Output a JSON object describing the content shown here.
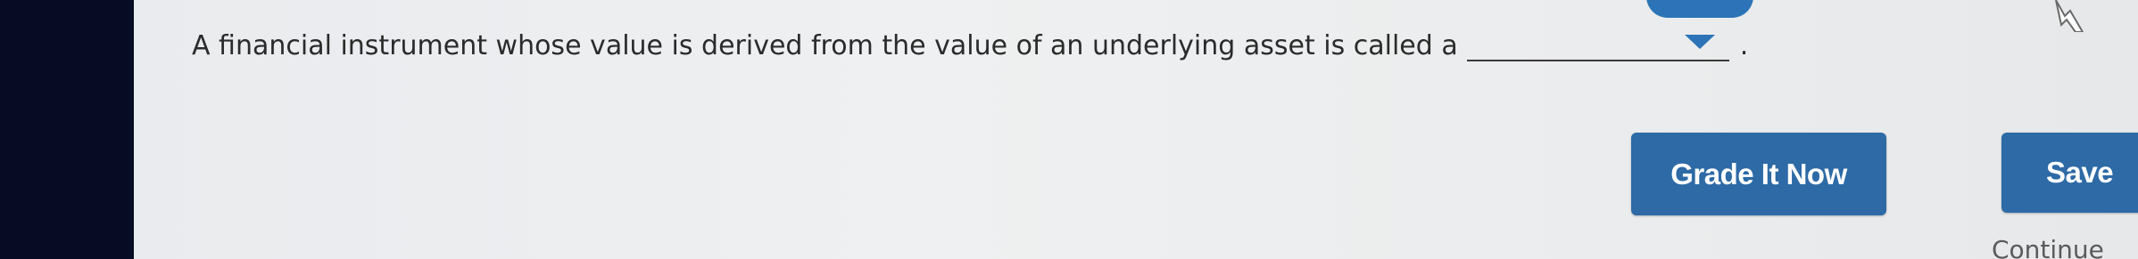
{
  "question": {
    "text": "A financial instrument whose value is derived from the value of an underlying asset is called a",
    "selected_value": "",
    "end_punctuation": "."
  },
  "buttons": {
    "grade_label": "Grade It Now",
    "save_label": "Save",
    "continue_label": "Continue"
  },
  "icons": {
    "dropdown": "chevron-down-icon",
    "cursor": "mouse-pointer-icon"
  },
  "colors": {
    "accent": "#2c74b7",
    "button": "#2d6aa6",
    "background": "#eceef0",
    "left_edge": "#080b24"
  }
}
